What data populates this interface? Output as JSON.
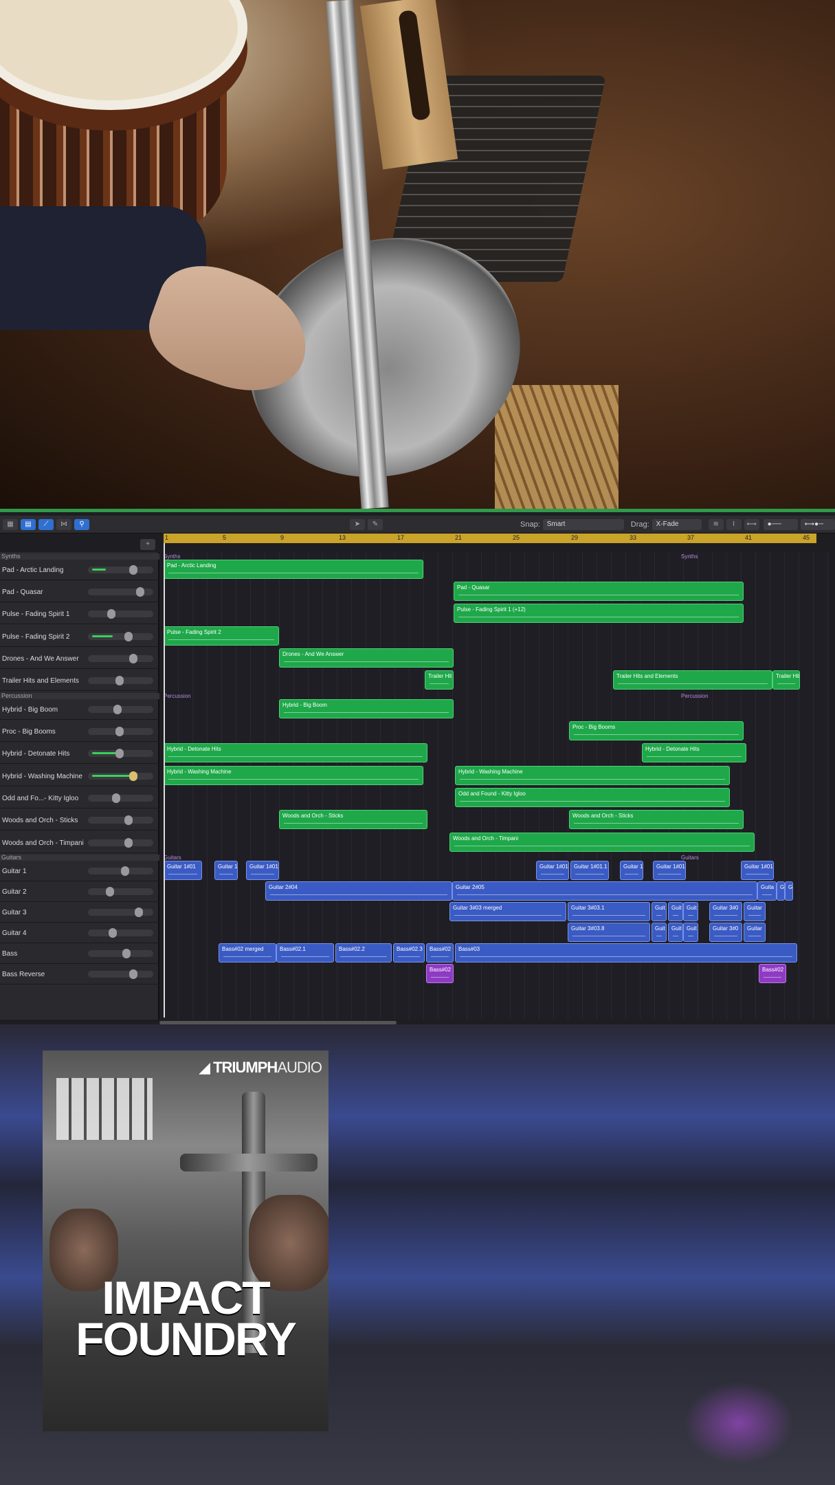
{
  "toolbar": {
    "snap_label": "Snap:",
    "snap_value": "Smart",
    "drag_label": "Drag:",
    "drag_value": "X-Fade"
  },
  "ruler": [
    "1",
    "5",
    "9",
    "13",
    "17",
    "21",
    "25",
    "29",
    "33",
    "37",
    "41",
    "45"
  ],
  "groups": {
    "synths": "Synths",
    "percussion": "Percussion",
    "guitars": "Guitars"
  },
  "tracks": [
    "Pad - Arctic Landing",
    "Pad - Quasar",
    "Pulse - Fading Spirit 1",
    "Pulse - Fading Spirit 2",
    "Drones - And We Answer",
    "Trailer Hits and Elements",
    "Hybrid - Big Boom",
    "Proc - Big Booms",
    "Hybrid - Detonate Hits",
    "Hybrid - Washing Machine",
    "Odd and Fo...- Kitty Igloo",
    "Woods and Orch - Sticks",
    "Woods and Orch - Timpani",
    "Guitar 1",
    "Guitar 2",
    "Guitar 3",
    "Guitar 4",
    "Bass",
    "Bass Reverse"
  ],
  "regions": {
    "pad_arctic": "Pad - Arctic Landing",
    "pad_quasar": "Pad - Quasar",
    "pulse1": "Pulse - Fading Spirit 1 (+12)",
    "pulse2": "Pulse - Fading Spirit 2",
    "drones": "Drones - And We Answer",
    "trailer_a": "Trailer Hit",
    "trailer_b": "Trailer Hits and Elements",
    "trailer_c": "Trailer Hit",
    "bigboom": "Hybrid - Big Boom",
    "procboom": "Proc - Big Booms",
    "deto_a": "Hybrid - Detonate Hits",
    "deto_b": "Hybrid - Detonate Hits",
    "wash_a": "Hybrid - Washing Machine",
    "wash_b": "Hybrid - Washing Machine",
    "kitty": "Odd and Found - Kitty Igloo",
    "sticks_a": "Woods and Orch - Sticks",
    "sticks_b": "Woods and Orch - Sticks",
    "timpani": "Woods and Orch - Timpani",
    "g1a": "Guitar 1#01",
    "g1b": "Guitar 1",
    "g1c": "Guitar 1#01",
    "g1d": "Guitar 1#01",
    "g1e": "Guitar 1#01.1",
    "g1f": "Guitar 1",
    "g1g": "Guitar 1#01",
    "g1h": "Guitar 1#01",
    "g2a": "Guitar 2#04",
    "g2b": "Guitar 2#05",
    "g2c": "Guita",
    "g2d": "G",
    "g2e": "G",
    "g3a": "Guitar 3#03 merged",
    "g3b": "Guitar 3#03.1",
    "g3c": "Guit",
    "g3d": "Guit",
    "g3e": "Guit",
    "g3f": "Guitar 3#0",
    "g3g": "Guitar",
    "g4a": "Guitar 3#03.8",
    "g4b": "Guit",
    "g4c": "Guit",
    "g4d": "Guit",
    "g4e": "Guitar 3#0",
    "g4f": "Guitar",
    "bassa": "Bass#02 merged",
    "bassb": "Bass#02.1",
    "bassc": "Bass#02.2",
    "bassd": "Bass#02.3",
    "basse": "Bass#02",
    "bassf": "Bass#03",
    "brev_a": "Bass#02",
    "brev_b": "Bass#02"
  },
  "promo": {
    "brand_a": "TRIUMPH",
    "brand_b": "AUDIO",
    "title_1": "IMPACT",
    "title_2": "FOUNDRY"
  }
}
